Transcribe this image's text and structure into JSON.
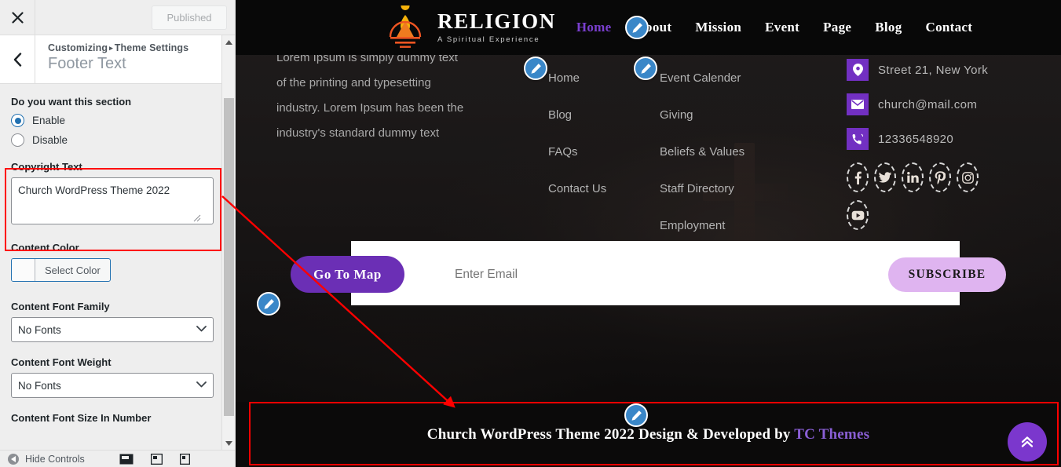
{
  "customizer": {
    "close_label": "Close customizer",
    "publish_button": "Published",
    "breadcrumb_prefix": "Customizing",
    "breadcrumb_separator": "▸",
    "breadcrumb_parent": "Theme Settings",
    "section_title": "Footer Text",
    "controls": {
      "section_toggle_label": "Do you want this section",
      "radio_enable": "Enable",
      "radio_disable": "Disable",
      "radio_selected": "Enable",
      "copyright_label": "Copyright Text",
      "copyright_value": "Church WordPress Theme 2022",
      "content_color_label": "Content Color",
      "select_color_button": "Select Color",
      "content_font_family_label": "Content Font Family",
      "content_font_family_value": "No Fonts",
      "content_font_weight_label": "Content Font Weight",
      "content_font_weight_value": "No Fonts",
      "content_font_size_label": "Content Font Size In Number"
    },
    "footer_bar": {
      "hide_controls": "Hide Controls",
      "device_desktop": "desktop-icon",
      "device_tablet": "tablet-icon",
      "device_mobile": "mobile-icon"
    }
  },
  "preview": {
    "site_header": {
      "brand_title": "RELIGION",
      "brand_subtitle": "A Spiritual Experience",
      "nav": [
        {
          "label": "Home",
          "active": true
        },
        {
          "label": "About",
          "active": false
        },
        {
          "label": "Mission",
          "active": false
        },
        {
          "label": "Event",
          "active": false
        },
        {
          "label": "Page",
          "active": false
        },
        {
          "label": "Blog",
          "active": false
        },
        {
          "label": "Contact",
          "active": false
        }
      ]
    },
    "footer": {
      "about_text": "Lorem Ipsum is simply dummy text of the printing and typesetting industry. Lorem Ipsum has been the industry's standard dummy text",
      "links_col1": [
        "Home",
        "Blog",
        "FAQs",
        "Contact Us"
      ],
      "links_col2": [
        "Event Calender",
        "Giving",
        "Beliefs & Values",
        "Staff Directory",
        "Employment"
      ],
      "contact": [
        {
          "icon": "map-pin-icon",
          "text": "Street 21, New York"
        },
        {
          "icon": "envelope-icon",
          "text": "church@mail.com"
        },
        {
          "icon": "phone-icon",
          "text": "12336548920"
        }
      ],
      "socials_row1": [
        "facebook-icon",
        "twitter-icon",
        "linkedin-icon",
        "pinterest-icon",
        "instagram-icon"
      ],
      "socials_row2": [
        "youtube-icon"
      ],
      "go_to_map_button": "Go To Map",
      "email_placeholder": "Enter Email",
      "subscribe_button": "SUBSCRIBE",
      "copyright_main": "Church WordPress Theme 2022 Design & Developed by ",
      "copyright_accent": "TC Themes",
      "back_to_top": "back-to-top-icon"
    }
  },
  "colors": {
    "accent_purple": "#7230c2",
    "nav_active": "#7a3fcf",
    "pin_blue": "#3a87c8",
    "annotation_red": "#ff0000",
    "subscribe_pink": "#dfb4f0",
    "wp_blue": "#2271b1"
  }
}
